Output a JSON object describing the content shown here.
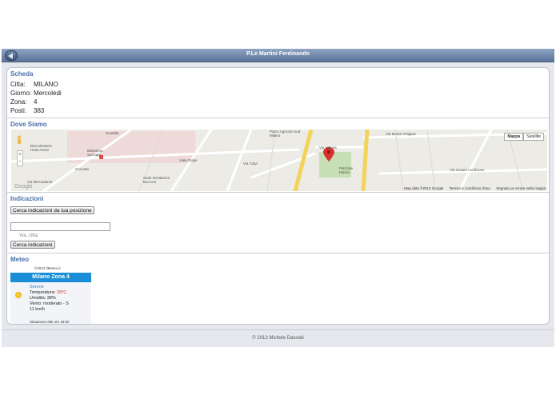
{
  "header": {
    "title": "P.Le Martini Ferdinando"
  },
  "scheda": {
    "title": "Scheda",
    "rows": [
      {
        "label": "Citta:",
        "value": "MILANO"
      },
      {
        "label": "Giorno:",
        "value": "Mercoledi"
      },
      {
        "label": "Zona:",
        "value": "4"
      },
      {
        "label": "Posti:",
        "value": "383"
      }
    ]
  },
  "map": {
    "title": "Dove Siamo",
    "type_buttons": [
      "Mappa",
      "Satellite"
    ],
    "labels": [
      "Gustalla",
      "Best Western Hotel Ascot",
      "Biblioteca Sormani",
      "Crocetta",
      "Sede Residenza Bocconi",
      "Parco Agricolo Sud Milano",
      "Via Vittoria",
      "Piazzale Martini",
      "Via Monte Ortigara",
      "Via Mercadante",
      "Via Cesare Lombroso",
      "Via Calvi",
      "Viale Piave"
    ],
    "footer": [
      "Map data ©2013 Google",
      "Termini e condizioni d'uso",
      "Segnala un errore nella mappa"
    ],
    "zoom_in": "+",
    "zoom_out": "−",
    "logo": "Google",
    "colors": {
      "road_major": "#f4d35a",
      "park": "#c7dfb5",
      "water": "#aac6e0"
    }
  },
  "indicazioni": {
    "title": "Indicazioni",
    "locate_button": "Cerca indicazioni da tua posizione",
    "input_value": "",
    "hint": "Via, citta",
    "search_button": "Cerca indicazioni"
  },
  "meteo": {
    "title": "Meteo",
    "copyright": "©2013 ilMeteo.it",
    "location": "Milano Zona 4",
    "sky": "Sereno",
    "temp_label": "Temperatura:",
    "temp_value": "29°C",
    "humidity": "Umidità: 38%",
    "wind": "Vento: moderato - S",
    "wind_speed": "11 km/h",
    "time": "Situazione alle ore 18:50",
    "icon": "sun-icon"
  },
  "footer": {
    "text": "© 2013 Michele Dassieli"
  }
}
